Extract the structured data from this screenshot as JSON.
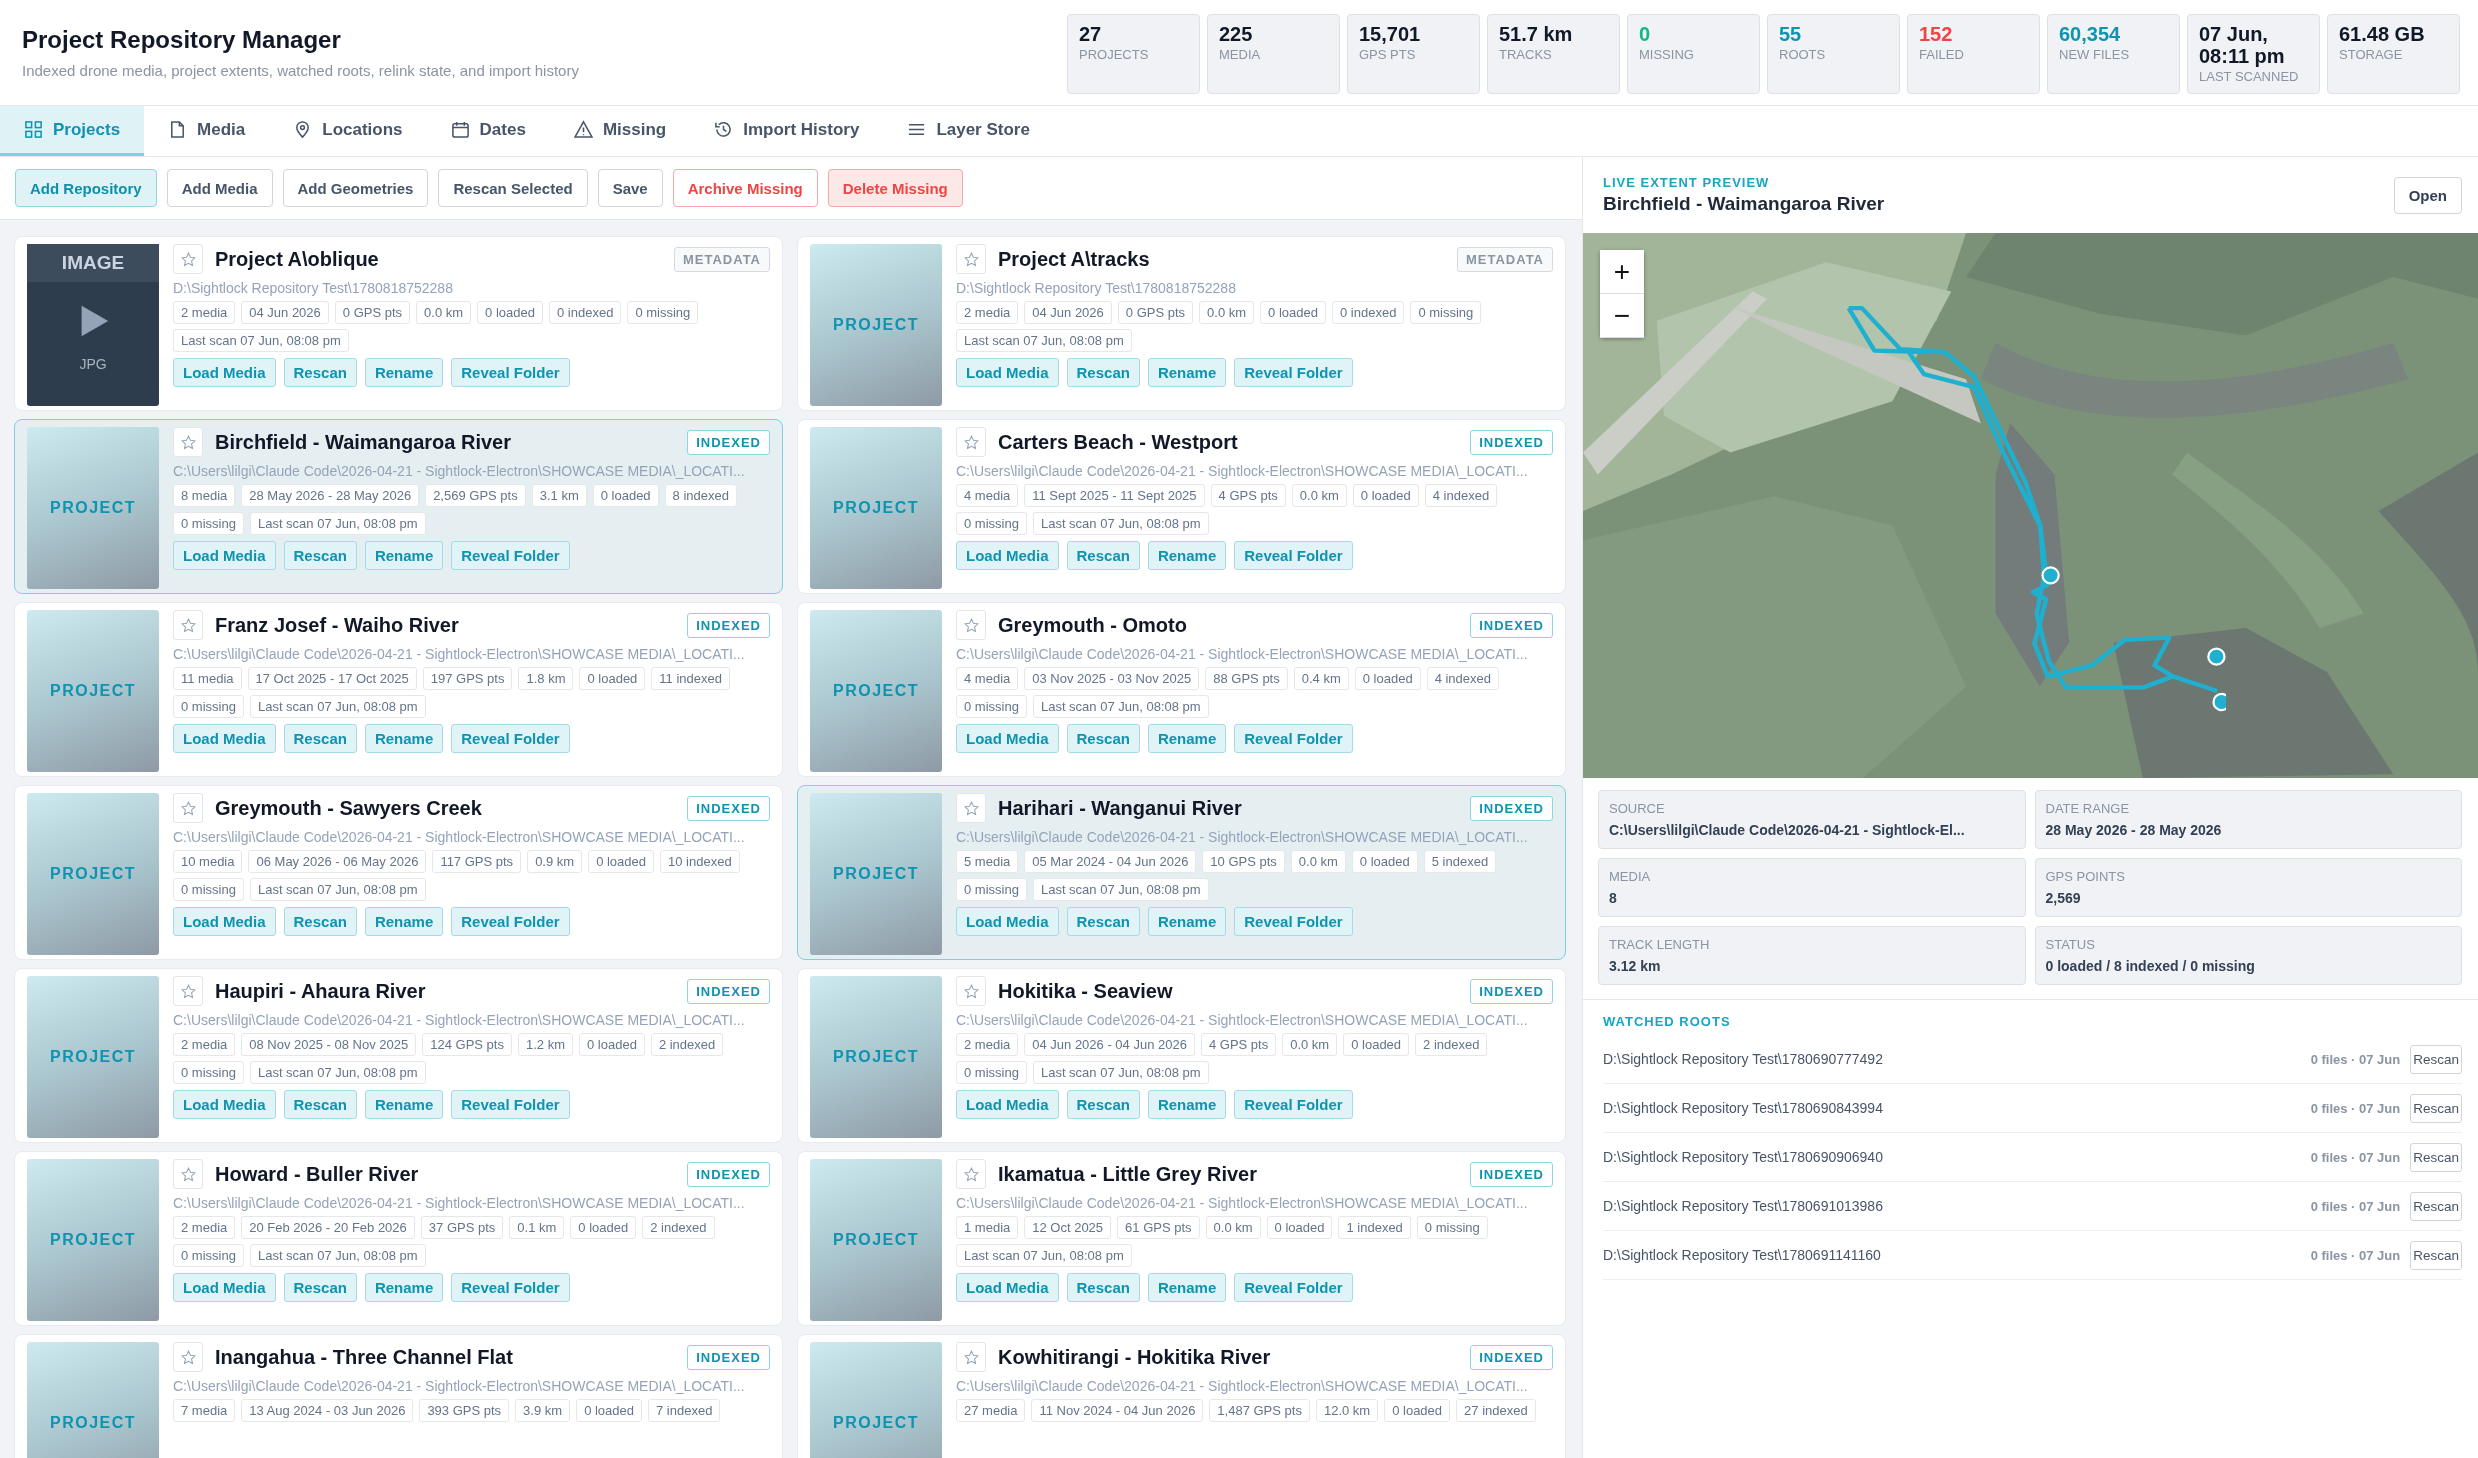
{
  "header": {
    "title": "Project Repository Manager",
    "subtitle": "Indexed drone media, project extents, watched roots, relink state, and import history"
  },
  "stats": [
    {
      "value": "27",
      "label": "PROJECTS",
      "color": "#111827"
    },
    {
      "value": "225",
      "label": "MEDIA",
      "color": "#111827"
    },
    {
      "value": "15,701",
      "label": "GPS PTS",
      "color": "#111827"
    },
    {
      "value": "51.7 km",
      "label": "TRACKS",
      "color": "#111827"
    },
    {
      "value": "0",
      "label": "MISSING",
      "color": "#10b981"
    },
    {
      "value": "55",
      "label": "ROOTS",
      "color": "#0e93b0"
    },
    {
      "value": "152",
      "label": "FAILED",
      "color": "#ef4444"
    },
    {
      "value": "60,354",
      "label": "NEW FILES",
      "color": "#0e93b0"
    },
    {
      "value": "07 Jun, 08:11 pm",
      "label": "LAST SCANNED",
      "color": "#111827"
    },
    {
      "value": "61.48 GB",
      "label": "STORAGE",
      "color": "#111827"
    }
  ],
  "tabs": [
    {
      "label": "Projects",
      "selected": true
    },
    {
      "label": "Media",
      "selected": false
    },
    {
      "label": "Locations",
      "selected": false
    },
    {
      "label": "Dates",
      "selected": false
    },
    {
      "label": "Missing",
      "selected": false
    },
    {
      "label": "Import History",
      "selected": false
    },
    {
      "label": "Layer Store",
      "selected": false
    }
  ],
  "toolbar": [
    {
      "label": "Add Repository",
      "kind": "primary"
    },
    {
      "label": "Add Media",
      "kind": "default"
    },
    {
      "label": "Add Geometries",
      "kind": "default"
    },
    {
      "label": "Rescan Selected",
      "kind": "default"
    },
    {
      "label": "Save",
      "kind": "default"
    },
    {
      "label": "Archive Missing",
      "kind": "warning"
    },
    {
      "label": "Delete Missing",
      "kind": "danger"
    }
  ],
  "projects": [
    {
      "name": "Project A\\oblique",
      "thumb": {
        "title": "IMAGE",
        "format": "JPG"
      },
      "starred": false,
      "selected": false,
      "badge": {
        "text": "METADATA",
        "kind": "metadata"
      },
      "path": "D:\\Sightlock Repository Test\\1780818752288",
      "chips": [
        "2 media",
        "04 Jun 2026",
        "0 GPS pts",
        "0.0 km",
        "0 loaded",
        "0 indexed",
        "0 missing",
        "Last scan 07 Jun, 08:08 pm"
      ],
      "actions": [
        "Load Media",
        "Rescan",
        "Rename",
        "Reveal Folder"
      ]
    },
    {
      "name": "Project A\\tracks",
      "thumb": {
        "kind": "project",
        "title": "PROJECT"
      },
      "starred": false,
      "selected": false,
      "badge": {
        "text": "METADATA",
        "kind": "metadata"
      },
      "path": "D:\\Sightlock Repository Test\\1780818752288",
      "chips": [
        "2 media",
        "04 Jun 2026",
        "0 GPS pts",
        "0.0 km",
        "0 loaded",
        "0 indexed",
        "0 missing",
        "Last scan 07 Jun, 08:08 pm"
      ],
      "actions": [
        "Load Media",
        "Rescan",
        "Rename",
        "Reveal Folder"
      ]
    },
    {
      "name": "Birchfield - Waimangaroa River",
      "thumb": {
        "kind": "project",
        "title": "PROJECT"
      },
      "starred": false,
      "selected": true,
      "badge": {
        "text": "INDEXED",
        "kind": "indexed"
      },
      "path": "C:\\Users\\lilgi\\Claude Code\\2026-04-21 - Sightlock-Electron\\SHOWCASE MEDIA\\_LOCATI...",
      "chips": [
        "8 media",
        "28 May 2026 - 28 May 2026",
        "2,569 GPS pts",
        "3.1 km",
        "0 loaded",
        "8 indexed",
        "0 missing",
        "Last scan 07 Jun, 08:08 pm"
      ],
      "actions": [
        "Load Media",
        "Rescan",
        "Rename",
        "Reveal Folder"
      ]
    },
    {
      "name": "Carters Beach - Westport",
      "thumb": {
        "kind": "project",
        "title": "PROJECT"
      },
      "starred": false,
      "selected": false,
      "badge": {
        "text": "INDEXED",
        "kind": "indexed"
      },
      "path": "C:\\Users\\lilgi\\Claude Code\\2026-04-21 - Sightlock-Electron\\SHOWCASE MEDIA\\_LOCATI...",
      "chips": [
        "4 media",
        "11 Sept 2025 - 11 Sept 2025",
        "4 GPS pts",
        "0.0 km",
        "0 loaded",
        "4 indexed",
        "0 missing",
        "Last scan 07 Jun, 08:08 pm"
      ],
      "actions": [
        "Load Media",
        "Rescan",
        "Rename",
        "Reveal Folder"
      ]
    },
    {
      "name": "Franz Josef - Waiho River",
      "thumb": {
        "kind": "project",
        "title": "PROJECT"
      },
      "starred": false,
      "selected": false,
      "badge": {
        "text": "INDEXED",
        "kind": "indexed"
      },
      "path": "C:\\Users\\lilgi\\Claude Code\\2026-04-21 - Sightlock-Electron\\SHOWCASE MEDIA\\_LOCATI...",
      "chips": [
        "11 media",
        "17 Oct 2025 - 17 Oct 2025",
        "197 GPS pts",
        "1.8 km",
        "0 loaded",
        "11 indexed",
        "0 missing",
        "Last scan 07 Jun, 08:08 pm"
      ],
      "actions": [
        "Load Media",
        "Rescan",
        "Rename",
        "Reveal Folder"
      ]
    },
    {
      "name": "Greymouth - Omoto",
      "thumb": {
        "kind": "project",
        "title": "PROJECT"
      },
      "starred": false,
      "selected": false,
      "badge": {
        "text": "INDEXED",
        "kind": "indexed"
      },
      "path": "C:\\Users\\lilgi\\Claude Code\\2026-04-21 - Sightlock-Electron\\SHOWCASE MEDIA\\_LOCATI...",
      "chips": [
        "4 media",
        "03 Nov 2025 - 03 Nov 2025",
        "88 GPS pts",
        "0.4 km",
        "0 loaded",
        "4 indexed",
        "0 missing",
        "Last scan 07 Jun, 08:08 pm"
      ],
      "actions": [
        "Load Media",
        "Rescan",
        "Rename",
        "Reveal Folder"
      ]
    },
    {
      "name": "Greymouth - Sawyers Creek",
      "thumb": {
        "kind": "project",
        "title": "PROJECT"
      },
      "starred": false,
      "selected": false,
      "badge": {
        "text": "INDEXED",
        "kind": "indexed"
      },
      "path": "C:\\Users\\lilgi\\Claude Code\\2026-04-21 - Sightlock-Electron\\SHOWCASE MEDIA\\_LOCATI...",
      "chips": [
        "10 media",
        "06 May 2026 - 06 May 2026",
        "117 GPS pts",
        "0.9 km",
        "0 loaded",
        "10 indexed",
        "0 missing",
        "Last scan 07 Jun, 08:08 pm"
      ],
      "actions": [
        "Load Media",
        "Rescan",
        "Rename",
        "Reveal Folder"
      ]
    },
    {
      "name": "Harihari - Wanganui River",
      "thumb": {
        "kind": "project",
        "title": "PROJECT"
      },
      "starred": false,
      "selected": true,
      "badge": {
        "text": "INDEXED",
        "kind": "indexed"
      },
      "path": "C:\\Users\\lilgi\\Claude Code\\2026-04-21 - Sightlock-Electron\\SHOWCASE MEDIA\\_LOCATI...",
      "chips": [
        "5 media",
        "05 Mar 2024 - 04 Jun 2026",
        "10 GPS pts",
        "0.0 km",
        "0 loaded",
        "5 indexed",
        "0 missing",
        "Last scan 07 Jun, 08:08 pm"
      ],
      "actions": [
        "Load Media",
        "Rescan",
        "Rename",
        "Reveal Folder"
      ]
    },
    {
      "name": "Haupiri - Ahaura River",
      "thumb": {
        "kind": "project",
        "title": "PROJECT"
      },
      "starred": false,
      "selected": false,
      "badge": {
        "text": "INDEXED",
        "kind": "indexed"
      },
      "path": "C:\\Users\\lilgi\\Claude Code\\2026-04-21 - Sightlock-Electron\\SHOWCASE MEDIA\\_LOCATI...",
      "chips": [
        "2 media",
        "08 Nov 2025 - 08 Nov 2025",
        "124 GPS pts",
        "1.2 km",
        "0 loaded",
        "2 indexed",
        "0 missing",
        "Last scan 07 Jun, 08:08 pm"
      ],
      "actions": [
        "Load Media",
        "Rescan",
        "Rename",
        "Reveal Folder"
      ]
    },
    {
      "name": "Hokitika - Seaview",
      "thumb": {
        "kind": "project",
        "title": "PROJECT"
      },
      "starred": false,
      "selected": false,
      "badge": {
        "text": "INDEXED",
        "kind": "indexed"
      },
      "path": "C:\\Users\\lilgi\\Claude Code\\2026-04-21 - Sightlock-Electron\\SHOWCASE MEDIA\\_LOCATI...",
      "chips": [
        "2 media",
        "04 Jun 2026 - 04 Jun 2026",
        "4 GPS pts",
        "0.0 km",
        "0 loaded",
        "2 indexed",
        "0 missing",
        "Last scan 07 Jun, 08:08 pm"
      ],
      "actions": [
        "Load Media",
        "Rescan",
        "Rename",
        "Reveal Folder"
      ]
    },
    {
      "name": "Howard - Buller River",
      "thumb": {
        "kind": "project",
        "title": "PROJECT"
      },
      "starred": false,
      "selected": false,
      "badge": {
        "text": "INDEXED",
        "kind": "indexed"
      },
      "path": "C:\\Users\\lilgi\\Claude Code\\2026-04-21 - Sightlock-Electron\\SHOWCASE MEDIA\\_LOCATI...",
      "chips": [
        "2 media",
        "20 Feb 2026 - 20 Feb 2026",
        "37 GPS pts",
        "0.1 km",
        "0 loaded",
        "2 indexed",
        "0 missing",
        "Last scan 07 Jun, 08:08 pm"
      ],
      "actions": [
        "Load Media",
        "Rescan",
        "Rename",
        "Reveal Folder"
      ]
    },
    {
      "name": "Ikamatua - Little Grey River",
      "thumb": {
        "kind": "project",
        "title": "PROJECT"
      },
      "starred": false,
      "selected": false,
      "badge": {
        "text": "INDEXED",
        "kind": "indexed"
      },
      "path": "C:\\Users\\lilgi\\Claude Code\\2026-04-21 - Sightlock-Electron\\SHOWCASE MEDIA\\_LOCATI...",
      "chips": [
        "1 media",
        "12 Oct 2025",
        "61 GPS pts",
        "0.0 km",
        "0 loaded",
        "1 indexed",
        "0 missing",
        "Last scan 07 Jun, 08:08 pm"
      ],
      "actions": [
        "Load Media",
        "Rescan",
        "Rename",
        "Reveal Folder"
      ]
    },
    {
      "name": "Inangahua - Three Channel Flat",
      "thumb": {
        "kind": "project",
        "title": "PROJECT"
      },
      "starred": false,
      "selected": false,
      "badge": {
        "text": "INDEXED",
        "kind": "indexed"
      },
      "path": "C:\\Users\\lilgi\\Claude Code\\2026-04-21 - Sightlock-Electron\\SHOWCASE MEDIA\\_LOCATI...",
      "chips": [
        "7 media",
        "13 Aug 2024 - 03 Jun 2026",
        "393 GPS pts",
        "3.9 km",
        "0 loaded",
        "7 indexed"
      ]
    },
    {
      "name": "Kowhitirangi - Hokitika River",
      "thumb": {
        "kind": "project",
        "title": "PROJECT"
      },
      "starred": false,
      "selected": false,
      "badge": {
        "text": "INDEXED",
        "kind": "indexed"
      },
      "path": "C:\\Users\\lilgi\\Claude Code\\2026-04-21 - Sightlock-Electron\\SHOWCASE MEDIA\\_LOCATI...",
      "chips": [
        "27 media",
        "11 Nov 2024 - 04 Jun 2026",
        "1,487 GPS pts",
        "12.0 km",
        "0 loaded",
        "27 indexed"
      ]
    }
  ],
  "preview": {
    "eyebrow": "LIVE EXTENT PREVIEW",
    "title": "Birchfield - Waimangaroa River",
    "open": "Open",
    "zoom_in": "+",
    "zoom_out": "−",
    "details": [
      {
        "label": "SOURCE",
        "value": "C:\\Users\\lilgi\\Claude Code\\2026-04-21 - Sightlock-El..."
      },
      {
        "label": "DATE RANGE",
        "value": "28 May 2026 - 28 May 2026"
      },
      {
        "label": "MEDIA",
        "value": "8"
      },
      {
        "label": "GPS POINTS",
        "value": "2,569"
      },
      {
        "label": "TRACK LENGTH",
        "value": "3.12 km"
      },
      {
        "label": "STATUS",
        "value": "0 loaded / 8 indexed / 0 missing"
      }
    ]
  },
  "watched_roots": {
    "title": "WATCHED ROOTS",
    "roots": [
      {
        "path": "D:\\Sightlock Repository Test\\1780690777492",
        "meta": "0 files · 07 Jun",
        "action": "Rescan"
      },
      {
        "path": "D:\\Sightlock Repository Test\\1780690843994",
        "meta": "0 files · 07 Jun",
        "action": "Rescan"
      },
      {
        "path": "D:\\Sightlock Repository Test\\1780690906940",
        "meta": "0 files · 07 Jun",
        "action": "Rescan"
      },
      {
        "path": "D:\\Sightlock Repository Test\\1780691013986",
        "meta": "0 files · 07 Jun",
        "action": "Rescan"
      },
      {
        "path": "D:\\Sightlock Repository Test\\1780691141160",
        "meta": "0 files · 07 Jun",
        "action": "Rescan"
      }
    ]
  }
}
